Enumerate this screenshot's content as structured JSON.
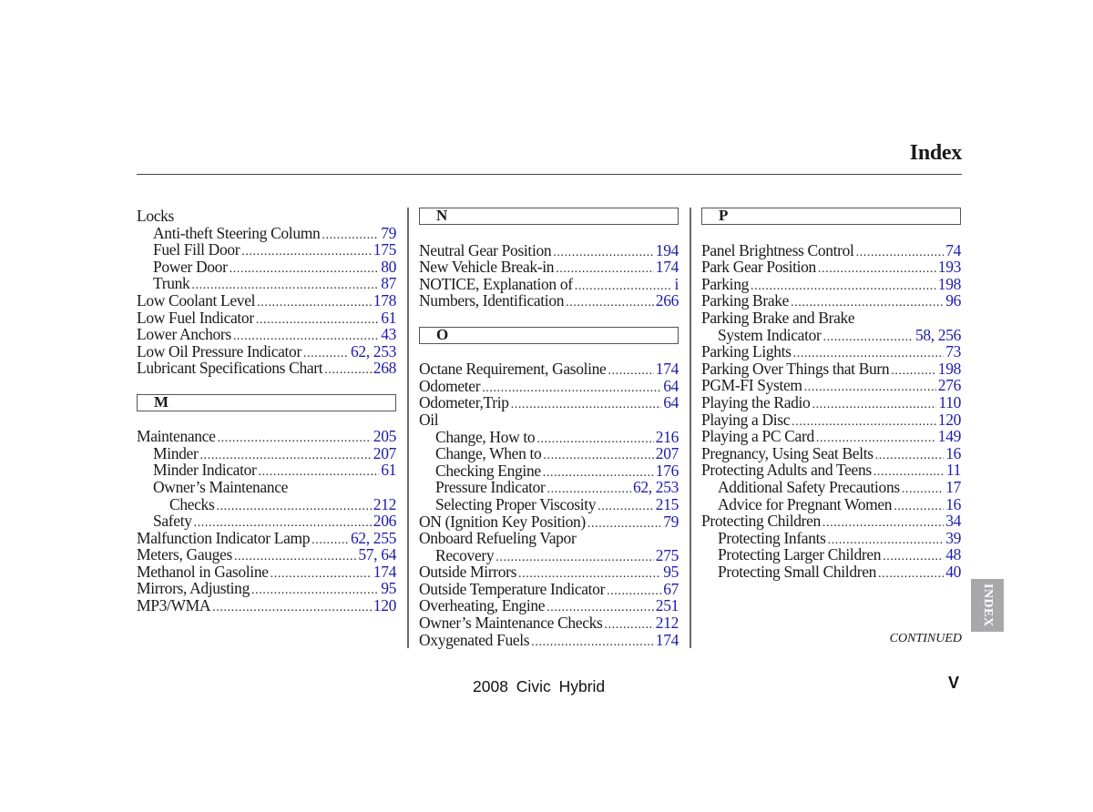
{
  "header": {
    "title": "Index"
  },
  "columns": [
    {
      "sections": [
        {
          "letter": null,
          "entries": [
            {
              "label": "Locks",
              "level": 0,
              "pages": ""
            },
            {
              "label": "Anti-theft Steering Column",
              "level": 1,
              "pages": "79"
            },
            {
              "label": "Fuel Fill Door",
              "level": 1,
              "pages": "175"
            },
            {
              "label": "Power Door",
              "level": 1,
              "pages": "80"
            },
            {
              "label": "Trunk",
              "level": 1,
              "pages": "87"
            },
            {
              "label": "Low Coolant Level",
              "level": 0,
              "pages": "178"
            },
            {
              "label": "Low Fuel Indicator",
              "level": 0,
              "pages": "61"
            },
            {
              "label": "Lower Anchors",
              "level": 0,
              "pages": "43"
            },
            {
              "label": "Low Oil Pressure Indicator",
              "level": 0,
              "pages": "62, 253"
            },
            {
              "label": "Lubricant Specifications Chart",
              "level": 0,
              "pages": "268"
            }
          ]
        },
        {
          "letter": "M",
          "entries": [
            {
              "label": "Maintenance",
              "level": 0,
              "pages": "205"
            },
            {
              "label": "Minder",
              "level": 1,
              "pages": "207"
            },
            {
              "label": "Minder Indicator",
              "level": 1,
              "pages": "61"
            },
            {
              "label": "Owner’s Maintenance",
              "level": 1,
              "pages": ""
            },
            {
              "label": "Checks",
              "level": 2,
              "pages": "212"
            },
            {
              "label": "Safety",
              "level": 1,
              "pages": "206"
            },
            {
              "label": "Malfunction Indicator Lamp",
              "level": 0,
              "pages": "62, 255"
            },
            {
              "label": "Meters, Gauges",
              "level": 0,
              "pages": "57, 64"
            },
            {
              "label": "Methanol in Gasoline",
              "level": 0,
              "pages": "174"
            },
            {
              "label": "Mirrors, Adjusting",
              "level": 0,
              "pages": "95"
            },
            {
              "label": "MP3/WMA",
              "level": 0,
              "pages": "120"
            }
          ]
        }
      ]
    },
    {
      "sections": [
        {
          "letter": "N",
          "entries": [
            {
              "label": "Neutral Gear Position",
              "level": 0,
              "pages": "194"
            },
            {
              "label": "New Vehicle Break-in",
              "level": 0,
              "pages": "174"
            },
            {
              "label": "NOTICE, Explanation of",
              "level": 0,
              "pages": "i"
            },
            {
              "label": "Numbers, Identification",
              "level": 0,
              "pages": "266"
            }
          ]
        },
        {
          "letter": "O",
          "entries": [
            {
              "label": "Octane Requirement, Gasoline",
              "level": 0,
              "pages": "174"
            },
            {
              "label": "Odometer",
              "level": 0,
              "pages": "64"
            },
            {
              "label": "Odometer,Trip",
              "level": 0,
              "pages": "64"
            },
            {
              "label": "Oil",
              "level": 0,
              "pages": ""
            },
            {
              "label": "Change, How to",
              "level": 1,
              "pages": "216"
            },
            {
              "label": "Change, When to",
              "level": 1,
              "pages": "207"
            },
            {
              "label": "Checking Engine",
              "level": 1,
              "pages": "176"
            },
            {
              "label": "Pressure Indicator",
              "level": 1,
              "pages": "62, 253"
            },
            {
              "label": "Selecting Proper Viscosity",
              "level": 1,
              "pages": "215"
            },
            {
              "label": "ON (Ignition Key Position)",
              "level": 0,
              "pages": "79"
            },
            {
              "label": "Onboard Refueling Vapor",
              "level": 0,
              "pages": ""
            },
            {
              "label": "Recovery",
              "level": 1,
              "pages": "275"
            },
            {
              "label": "Outside Mirrors",
              "level": 0,
              "pages": "95"
            },
            {
              "label": "Outside Temperature Indicator",
              "level": 0,
              "pages": "67"
            },
            {
              "label": "Overheating, Engine",
              "level": 0,
              "pages": "251"
            },
            {
              "label": "Owner’s Maintenance Checks",
              "level": 0,
              "pages": "212"
            },
            {
              "label": "Oxygenated Fuels",
              "level": 0,
              "pages": "174"
            }
          ]
        }
      ]
    },
    {
      "sections": [
        {
          "letter": "P",
          "entries": [
            {
              "label": "Panel Brightness Control",
              "level": 0,
              "pages": "74"
            },
            {
              "label": "Park Gear Position",
              "level": 0,
              "pages": "193"
            },
            {
              "label": "Parking",
              "level": 0,
              "pages": "198"
            },
            {
              "label": "Parking Brake",
              "level": 0,
              "pages": "96"
            },
            {
              "label": "Parking Brake and Brake",
              "level": 0,
              "pages": ""
            },
            {
              "label": "System Indicator",
              "level": 1,
              "pages": "58, 256"
            },
            {
              "label": "Parking Lights",
              "level": 0,
              "pages": "73"
            },
            {
              "label": "Parking Over Things that Burn",
              "level": 0,
              "pages": "198"
            },
            {
              "label": "PGM-FI System",
              "level": 0,
              "pages": "276"
            },
            {
              "label": "Playing the Radio",
              "level": 0,
              "pages": "110"
            },
            {
              "label": "Playing a Disc",
              "level": 0,
              "pages": "120"
            },
            {
              "label": "Playing a PC Card",
              "level": 0,
              "pages": "149"
            },
            {
              "label": "Pregnancy, Using Seat Belts",
              "level": 0,
              "pages": "16"
            },
            {
              "label": "Protecting Adults and Teens",
              "level": 0,
              "pages": "11"
            },
            {
              "label": "Additional Safety Precautions",
              "level": 1,
              "pages": "17"
            },
            {
              "label": "Advice for Pregnant Women",
              "level": 1,
              "pages": "16"
            },
            {
              "label": "Protecting Children",
              "level": 0,
              "pages": "34"
            },
            {
              "label": "Protecting Infants",
              "level": 1,
              "pages": "39"
            },
            {
              "label": "Protecting Larger Children",
              "level": 1,
              "pages": "48"
            },
            {
              "label": "Protecting Small Children",
              "level": 1,
              "pages": "40"
            }
          ]
        }
      ]
    }
  ],
  "side_tab": {
    "label": "INDEX"
  },
  "continued_label": "CONTINUED",
  "footer": {
    "model": "2008 Civic Hybrid",
    "page_number": "V"
  },
  "colors": {
    "page_link": "#1c1ca8",
    "text": "#1a1a1a",
    "tab_bg": "#a8a8aa"
  }
}
